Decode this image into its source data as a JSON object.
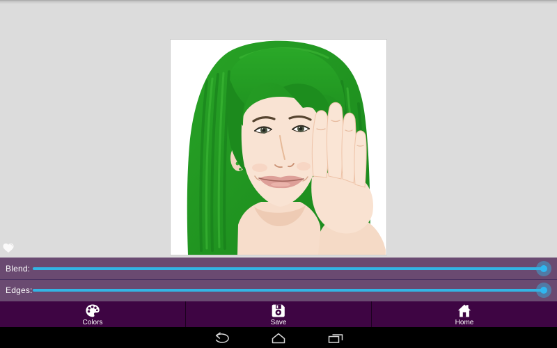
{
  "canvas": {
    "background_color": "#dcdcdc",
    "photo_description": "Studio portrait of a smiling woman with long straight hair recolored bright green, bangs swept right, right hand resting against her cheek, white background",
    "favorite_icon": "heart-icon"
  },
  "sliders": {
    "panel_color": "#6a4a71",
    "track_color": "#33b5e5",
    "items": [
      {
        "label": "Blend:",
        "value_percent": 100
      },
      {
        "label": "Edges:",
        "value_percent": 100
      }
    ]
  },
  "toolbar": {
    "background_color": "#3e0543",
    "buttons": [
      {
        "label": "Colors",
        "icon": "palette-icon"
      },
      {
        "label": "Save",
        "icon": "save-icon"
      },
      {
        "label": "Home",
        "icon": "home-icon"
      }
    ]
  },
  "navbar": {
    "background_color": "#000000",
    "buttons": [
      {
        "icon": "back-icon"
      },
      {
        "icon": "home-icon"
      },
      {
        "icon": "recents-icon"
      }
    ]
  }
}
